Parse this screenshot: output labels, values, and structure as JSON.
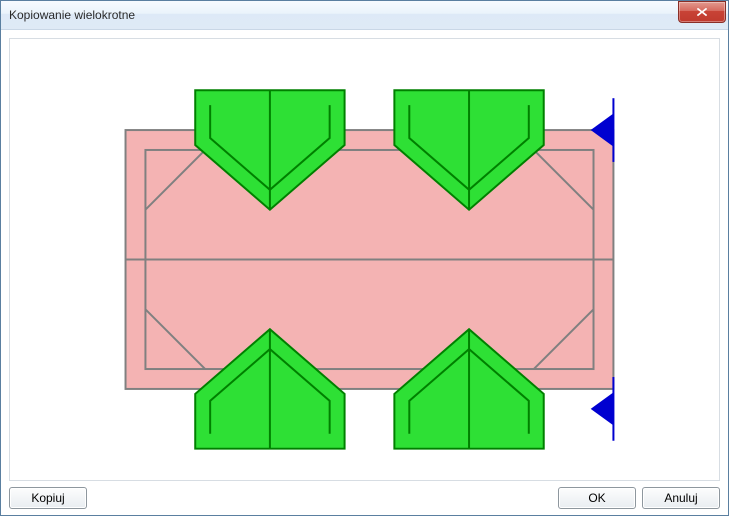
{
  "window": {
    "title": "Kopiowanie wielokrotne"
  },
  "buttons": {
    "copy": "Kopiuj",
    "ok": "OK",
    "cancel": "Anuluj"
  }
}
